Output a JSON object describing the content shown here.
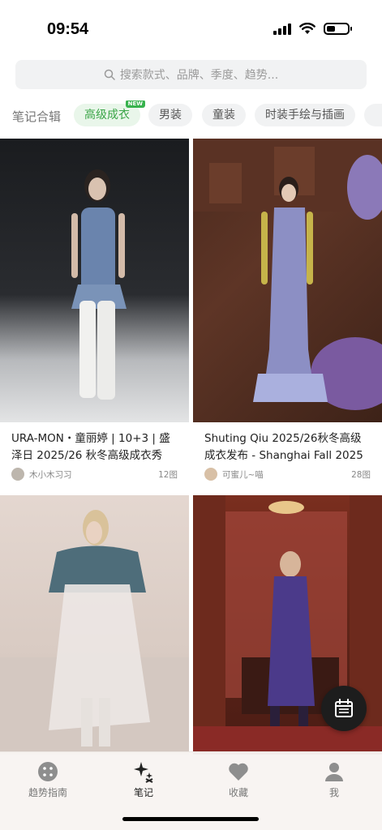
{
  "status_bar": {
    "time": "09:54"
  },
  "search": {
    "placeholder": "搜索款式、品牌、季度、趋势..."
  },
  "chips": {
    "label": "笔记合辑",
    "items": [
      {
        "label": "高级成衣",
        "badge": "NEW",
        "active": true
      },
      {
        "label": "男装"
      },
      {
        "label": "童装"
      },
      {
        "label": "时装手绘与插画"
      }
    ]
  },
  "feed": [
    {
      "title": "URA-MON・童丽婷 | 10+3 | 盛泽日 2025/26 秋冬高级成衣秀",
      "author": "木小木习习",
      "count": "12图"
    },
    {
      "title": "Shuting Qiu 2025/26秋冬高级成衣发布 - Shanghai Fall 2025",
      "author": "可蜜儿~喵",
      "count": "28图"
    },
    {
      "title": "",
      "author": "",
      "count": ""
    },
    {
      "title": "",
      "author": "",
      "count": ""
    }
  ],
  "tabbar": {
    "items": [
      {
        "label": "趋势指南",
        "icon": "dots-grid-icon"
      },
      {
        "label": "笔记",
        "icon": "sparkle-icon",
        "active": true
      },
      {
        "label": "收藏",
        "icon": "heart-icon"
      },
      {
        "label": "我",
        "icon": "person-icon"
      }
    ]
  },
  "colors": {
    "accent": "#3aa547",
    "chip_bg": "#f1f2f3",
    "fab_bg": "#1d1d1d"
  }
}
